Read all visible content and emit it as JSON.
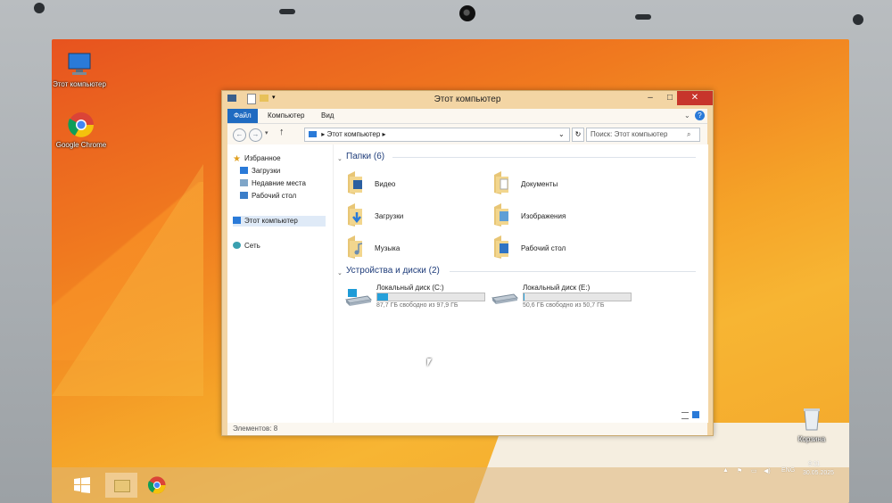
{
  "desktop": {
    "icons": [
      {
        "label": "Этот компьютер"
      },
      {
        "label": "Google Chrome"
      },
      {
        "label": "Корзина"
      }
    ]
  },
  "window": {
    "title": "Этот компьютер",
    "ribbon_tabs": [
      "Файл",
      "Компьютер",
      "Вид"
    ],
    "address": "Этот компьютер",
    "search_placeholder": "Поиск: Этот компьютер",
    "nav": {
      "favorites": "Избранное",
      "downloads": "Загрузки",
      "recent": "Недавние места",
      "desktop": "Рабочий стол",
      "this_pc": "Этот компьютер",
      "network": "Сеть"
    },
    "folders_header": "Папки (6)",
    "folders": [
      "Видео",
      "Документы",
      "Загрузки",
      "Изображения",
      "Музыка",
      "Рабочий стол"
    ],
    "devices_header": "Устройства и диски (2)",
    "drives": [
      {
        "name": "Локальный диск (C:)",
        "space": "87,7 ГБ свободно из 97,9 ГБ",
        "used_fraction": 0.104
      },
      {
        "name": "Локальный диск (E:)",
        "space": "50,6 ГБ свободно из 50,7 ГБ",
        "used_fraction": 0.002
      }
    ],
    "status": "Элементов: 8"
  },
  "taskbar": {
    "lang": "ENG",
    "time": "9:11",
    "date": "30.05.2025"
  },
  "colors": {
    "accent": "#1f6bc1",
    "close": "#c7352b",
    "drive_fill": "#26a0da"
  }
}
